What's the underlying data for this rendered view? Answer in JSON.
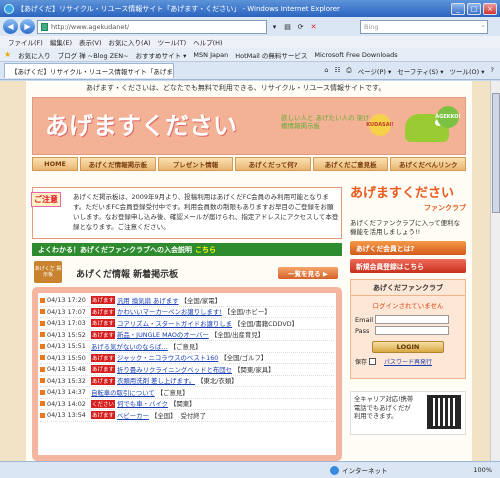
{
  "window": {
    "title": "【あげくだ】リサイクル・リユース情報サイト「あげます・ください」 - Windows Internet Explorer",
    "controls": [
      "_",
      "□",
      "×"
    ]
  },
  "address_bar": {
    "url": "http://www.agekudanet/",
    "search_placeholder": "Bing"
  },
  "menu": [
    "ファイル(F)",
    "編集(E)",
    "表示(V)",
    "お気に入り(A)",
    "ツール(T)",
    "ヘルプ(H)"
  ],
  "favorites_bar": {
    "label": "お気に入り",
    "items": [
      "ブログ 禅 ~Blog ZEN~",
      "おすすめサイト ▾",
      "MSN Japan",
      "HotMail の無料サービス",
      "Microsoft Free Downloads"
    ]
  },
  "tab": {
    "title": "【あげくだ】リサイクル・リユース情報サイト「あげます・くださ..."
  },
  "command_bar": [
    "ページ(P) ▾",
    "セーフティ(S) ▾",
    "ツール(O) ▾"
  ],
  "page": {
    "tagline": "あげます・くださいは、どなたでも無料で利用できる、リサイクル・リユース情報サイトです。",
    "logo": "あげますください",
    "logo_sub": "欲しい人と あげたい人の 架け橋情報掲示板",
    "badge_kudasai": "KUDASAI!",
    "badge_agekko": "AGEKKO!",
    "nav": [
      "HOME",
      "あげくだ情報掲示板",
      "プレゼント情報",
      "あげくだって何?",
      "あげくだご意見板",
      "あげくだべんリンク"
    ],
    "notice": {
      "badge": "ご注意",
      "text": "あげくだ掲示板は、2009年9月より、投稿利用はあげくだFC会員のみ利用可能となります。ただいまFC会員登録受付中です。利用会員数の制限もありますお早目のご登録をお願いします。なお登録申し込み後、確認メールが届けられ、指定アドレスにアクセスして本登録となります。ご注意ください。"
    },
    "club_banner": {
      "text": "よくわかる！あげくだファンクラブへの入会説明",
      "link": "こちら"
    },
    "board": {
      "sign": "あげくだ 掲示板",
      "heading": "あげくだ情報 新着掲示板",
      "more_button": "一覧を見る ▶",
      "posts": [
        {
          "time": "04/13 17:20",
          "tag": "あげます",
          "title": "汎用 換気扇 あげます",
          "cat": "【全国/家電】",
          "status": ""
        },
        {
          "time": "04/13 17:07",
          "tag": "あげます",
          "title": "かわいいマーカーペンお譲りします!",
          "cat": "【全国/ホビー】",
          "status": ""
        },
        {
          "time": "04/13 17:03",
          "tag": "あげます",
          "title": "コアリズム・スタートガイドお譲りしま",
          "cat": "【全国/書籍CDDVD】",
          "status": ""
        },
        {
          "time": "04/13 15:52",
          "tag": "あげます",
          "title": "新品・JUNGLE MAOのオーバー",
          "cat": "【全国/出産育児】",
          "status": ""
        },
        {
          "time": "04/13 15:51",
          "tag": "",
          "title": "あげる気がないのならば…",
          "cat": "【ご意見】",
          "status": ""
        },
        {
          "time": "04/13 15:50",
          "tag": "あげます",
          "title": "ジャック・ニコラウスのベスト160",
          "cat": "【全国/ゴルフ】",
          "status": ""
        },
        {
          "time": "04/13 15:48",
          "tag": "あげます",
          "title": "折り畳みリクライニングベッドと布団セ",
          "cat": "【関東/家具】",
          "status": ""
        },
        {
          "time": "04/13 15:32",
          "tag": "あげます",
          "title": "衣類用洗剤 差し上げます。",
          "cat": "【東北/衣類】",
          "status": ""
        },
        {
          "time": "04/13 14:37",
          "tag": "",
          "title": "自転車の取引について",
          "cat": "【ご意見】",
          "status": ""
        },
        {
          "time": "04/13 14:02",
          "tag": "ください",
          "title": "何でも車・バイク",
          "cat": "【関東】",
          "status": ""
        },
        {
          "time": "04/13 13:54",
          "tag": "あげます",
          "title": "ベビーカー",
          "cat": "【全国】",
          "status": "受付終了"
        }
      ]
    },
    "side": {
      "club_logo": "あげますください",
      "club_logo_sub": "ファンクラブ",
      "desc": "あげくだファンクラブに入って便利な機能を活用しましょう!!",
      "btn_about": "あげくだ会員とは?",
      "btn_register": "新規会員登録はこちら",
      "login": {
        "header": "あげくだファンクラブ",
        "status": "ログインされていません",
        "email_label": "Email",
        "pass_label": "Pass",
        "button": "LOGIN",
        "save_label": "保存",
        "reset_link": "パスワード再発行"
      },
      "mobile": "全キャリア対応!携帯電話でもあげくだが利用できます。"
    }
  },
  "status_bar": {
    "zone": "インターネット",
    "zoom": "100%"
  }
}
